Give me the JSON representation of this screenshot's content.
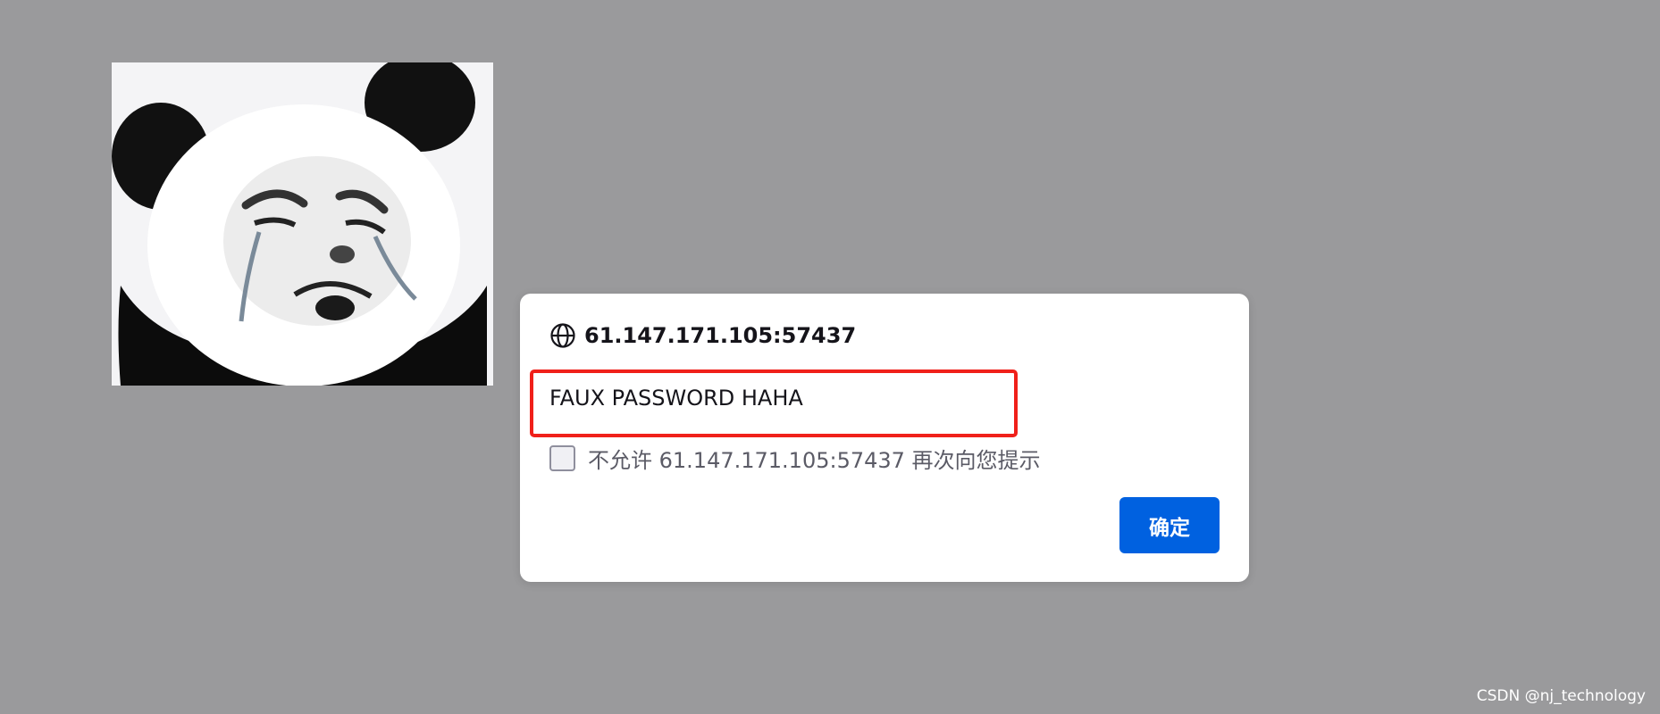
{
  "dialog": {
    "origin": "61.147.171.105:57437",
    "origin_icon": "globe-icon",
    "message": "FAUX PASSWORD HAHA",
    "suppress_label": "不允许 61.147.171.105:57437 再次向您提示",
    "suppress_checked": false,
    "ok_label": "确定"
  },
  "page": {
    "image_subject": "panda-meme-crying",
    "watermark": "CSDN @nj_technology"
  },
  "colors": {
    "overlay_background": "#9a9a9c",
    "dialog_background": "#ffffff",
    "primary_button": "#0061e0",
    "highlight_border": "#f0201a"
  }
}
